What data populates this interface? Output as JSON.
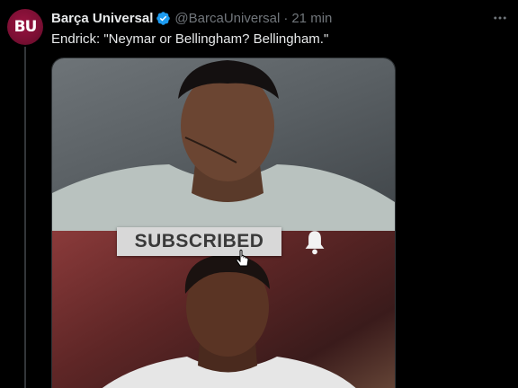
{
  "tweet": {
    "avatar_text": "BU",
    "display_name": "Barça Universal",
    "handle": "@BarcaUniversal",
    "separator": "·",
    "time": "21 min",
    "text": "Endrick: \"Neymar or Bellingham? Bellingham.\""
  },
  "media": {
    "banner_text": "SUBSCRIBED",
    "icons": [
      "bell-icon",
      "cursor-icon"
    ]
  },
  "icons": {
    "verified": "verified-badge-icon",
    "more": "more-icon"
  },
  "colors": {
    "avatar": "#7a0f33",
    "verified": "#1d9bf0",
    "muted_text": "#71767b",
    "text": "#e7e9ea"
  }
}
